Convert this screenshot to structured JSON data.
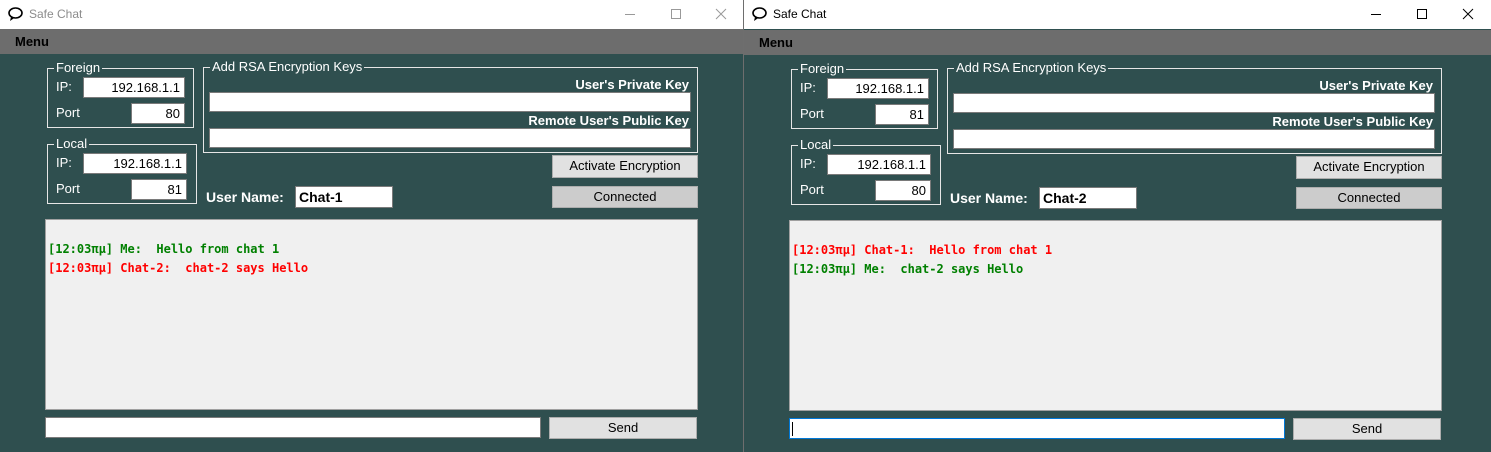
{
  "windows": [
    {
      "title": "Safe Chat",
      "menu": "Menu",
      "foreign": {
        "legend": "Foreign",
        "ip_label": "IP:",
        "ip": "192.168.1.1",
        "port_label": "Port",
        "port": "80"
      },
      "local": {
        "legend": "Local",
        "ip_label": "IP:",
        "ip": "192.168.1.1",
        "port_label": "Port",
        "port": "81"
      },
      "rsa": {
        "legend": "Add RSA Encryption Keys",
        "private_label": "User's Private Key",
        "private_value": "",
        "public_label": "Remote User's Public Key",
        "public_value": ""
      },
      "activate_label": "Activate Encryption",
      "status_label": "Connected",
      "username_label": "User Name:",
      "username": "Chat-1",
      "messages": [
        {
          "text": "[12:03πμ] Me:  Hello from chat 1",
          "color": "#008000"
        },
        {
          "text": "[12:03πμ] Chat-2:  chat-2 says Hello",
          "color": "#ff0000"
        }
      ],
      "input_value": "",
      "send_label": "Send"
    },
    {
      "title": "Safe Chat",
      "menu": "Menu",
      "foreign": {
        "legend": "Foreign",
        "ip_label": "IP:",
        "ip": "192.168.1.1",
        "port_label": "Port",
        "port": "81"
      },
      "local": {
        "legend": "Local",
        "ip_label": "IP:",
        "ip": "192.168.1.1",
        "port_label": "Port",
        "port": "80"
      },
      "rsa": {
        "legend": "Add RSA Encryption Keys",
        "private_label": "User's Private Key",
        "private_value": "",
        "public_label": "Remote User's Public Key",
        "public_value": ""
      },
      "activate_label": "Activate Encryption",
      "status_label": "Connected",
      "username_label": "User Name:",
      "username": "Chat-2",
      "messages": [
        {
          "text": "[12:03πμ] Chat-1:  Hello from chat 1",
          "color": "#ff0000"
        },
        {
          "text": "[12:03πμ] Me:  chat-2 says Hello",
          "color": "#008000"
        }
      ],
      "input_value": "",
      "send_label": "Send"
    }
  ],
  "icons": {
    "app": "chat-bubble-icon",
    "minimize": "minimize-icon",
    "maximize": "maximize-icon",
    "close": "close-icon"
  },
  "colors": {
    "background": "#2f4f4f",
    "menubar": "#6d6d6d",
    "log_background": "#f0f0f0",
    "own_message": "#008000",
    "remote_message": "#ff0000"
  }
}
